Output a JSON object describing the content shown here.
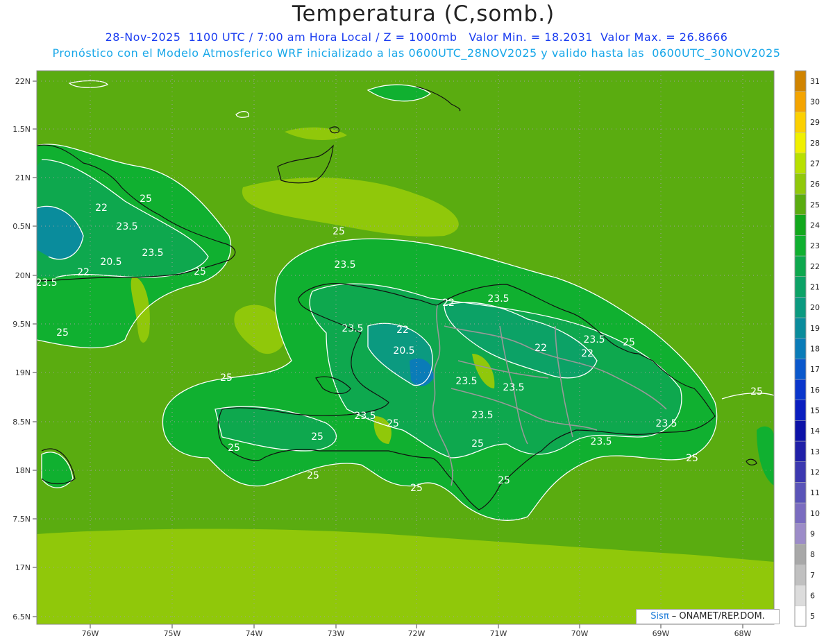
{
  "header": {
    "title": "Temperatura (C,somb.)",
    "line1": "28-Nov-2025  1100 UTC / 7:00 am Hora Local / Z = 1000mb   Valor Min. = 18.2031  Valor Max. = 26.8666",
    "line2": "Pronóstico con el Modelo Atmosferico WRF inicializado a las 0600UTC_28NOV2025 y valido hasta las  0600UTC_30NOV2025"
  },
  "axes": {
    "lat_labels": [
      "22N",
      "1.5N",
      "21N",
      "0.5N",
      "20N",
      "9.5N",
      "19N",
      "8.5N",
      "18N",
      "7.5N",
      "17N",
      "6.5N"
    ],
    "lon_labels": [
      "76W",
      "75W",
      "74W",
      "73W",
      "72W",
      "71W",
      "70W",
      "69W",
      "68W"
    ]
  },
  "colorbar": {
    "levels": [
      "5",
      "6",
      "7",
      "8",
      "9",
      "10",
      "11",
      "12",
      "13",
      "14",
      "15",
      "16",
      "17",
      "18",
      "19",
      "20",
      "21",
      "22",
      "23",
      "24",
      "25",
      "26",
      "27",
      "28",
      "29",
      "30",
      "31"
    ],
    "colors": [
      "#ffffff",
      "#dcdcdc",
      "#c0c0c0",
      "#a8a8a8",
      "#9c8cc8",
      "#7a6cc0",
      "#5a54b8",
      "#3c38b0",
      "#2020a8",
      "#0c12a8",
      "#0a1ec0",
      "#0a36cc",
      "#0a58cc",
      "#0a7cb8",
      "#0a8c9c",
      "#0b9a80",
      "#0ca266",
      "#0ea84e",
      "#10b030",
      "#12a81c",
      "#5aac10",
      "#90c80a",
      "#b8e000",
      "#f0f000",
      "#fcd000",
      "#f4a400",
      "#d08400"
    ]
  },
  "contour_labels": [
    "25",
    "22",
    "23.5",
    "20.5",
    "23.5",
    "22",
    "23.5",
    "25",
    "25",
    "23.5",
    "25",
    "23.5",
    "22",
    "20.5",
    "23.5",
    "22",
    "23.5",
    "22",
    "22",
    "23.5",
    "25",
    "25",
    "23.5",
    "23.5",
    "25",
    "23.5",
    "23.5",
    "25",
    "23.5",
    "25",
    "25",
    "25",
    "25",
    "25",
    "25",
    "25"
  ],
  "credit": {
    "brand": "Sisπ",
    "org": " – ONAMET/REP.DOM."
  }
}
